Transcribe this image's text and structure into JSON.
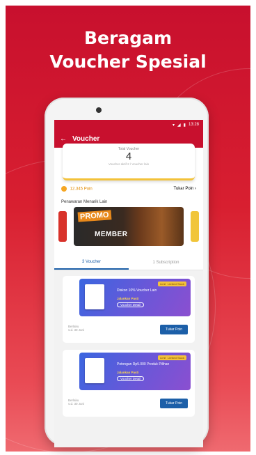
{
  "hero": {
    "headline_line1": "Beragam",
    "headline_line2": "Voucher Spesial",
    "background_color": "#c8102e"
  },
  "statusbar": {
    "time": "13:28"
  },
  "appbar": {
    "back_icon": "arrow-left-icon",
    "title": "Voucher"
  },
  "summary": {
    "label": "Total Voucher",
    "count": "4",
    "note": "Voucher aktif 2 / Voucher lain"
  },
  "points": {
    "coin_icon": "coin-icon",
    "value": "12.345 Poin",
    "link": "Tukar Poin ›"
  },
  "section": {
    "title": "Penawaran Menarik Lain"
  },
  "banner": {
    "promo": "PROMO",
    "member": "MEMBER"
  },
  "tabs": [
    {
      "label": "3 Voucher",
      "active": true
    },
    {
      "label": "1 Subscription",
      "active": false
    }
  ],
  "vouchers": [
    {
      "title": "Diskon 10%",
      "subtitle": "Voucher Lain",
      "caption": "Jalankan Pasti",
      "chip": "Voucher Detail",
      "tag1": "Limited",
      "tag2": "Limited Stock",
      "foot1": "Berlaku",
      "foot2": "s.d. 30 Juni",
      "button": "Tukar Poin"
    },
    {
      "title": "Potongan Rp5.000",
      "subtitle": "Produk Pilihan",
      "caption": "Jalankan Pasti",
      "chip": "Voucher Detail",
      "tag1": "Limited",
      "tag2": "Limited Stock",
      "foot1": "Berlaku",
      "foot2": "s.d. 30 Juni",
      "button": "Tukar Poin"
    }
  ]
}
